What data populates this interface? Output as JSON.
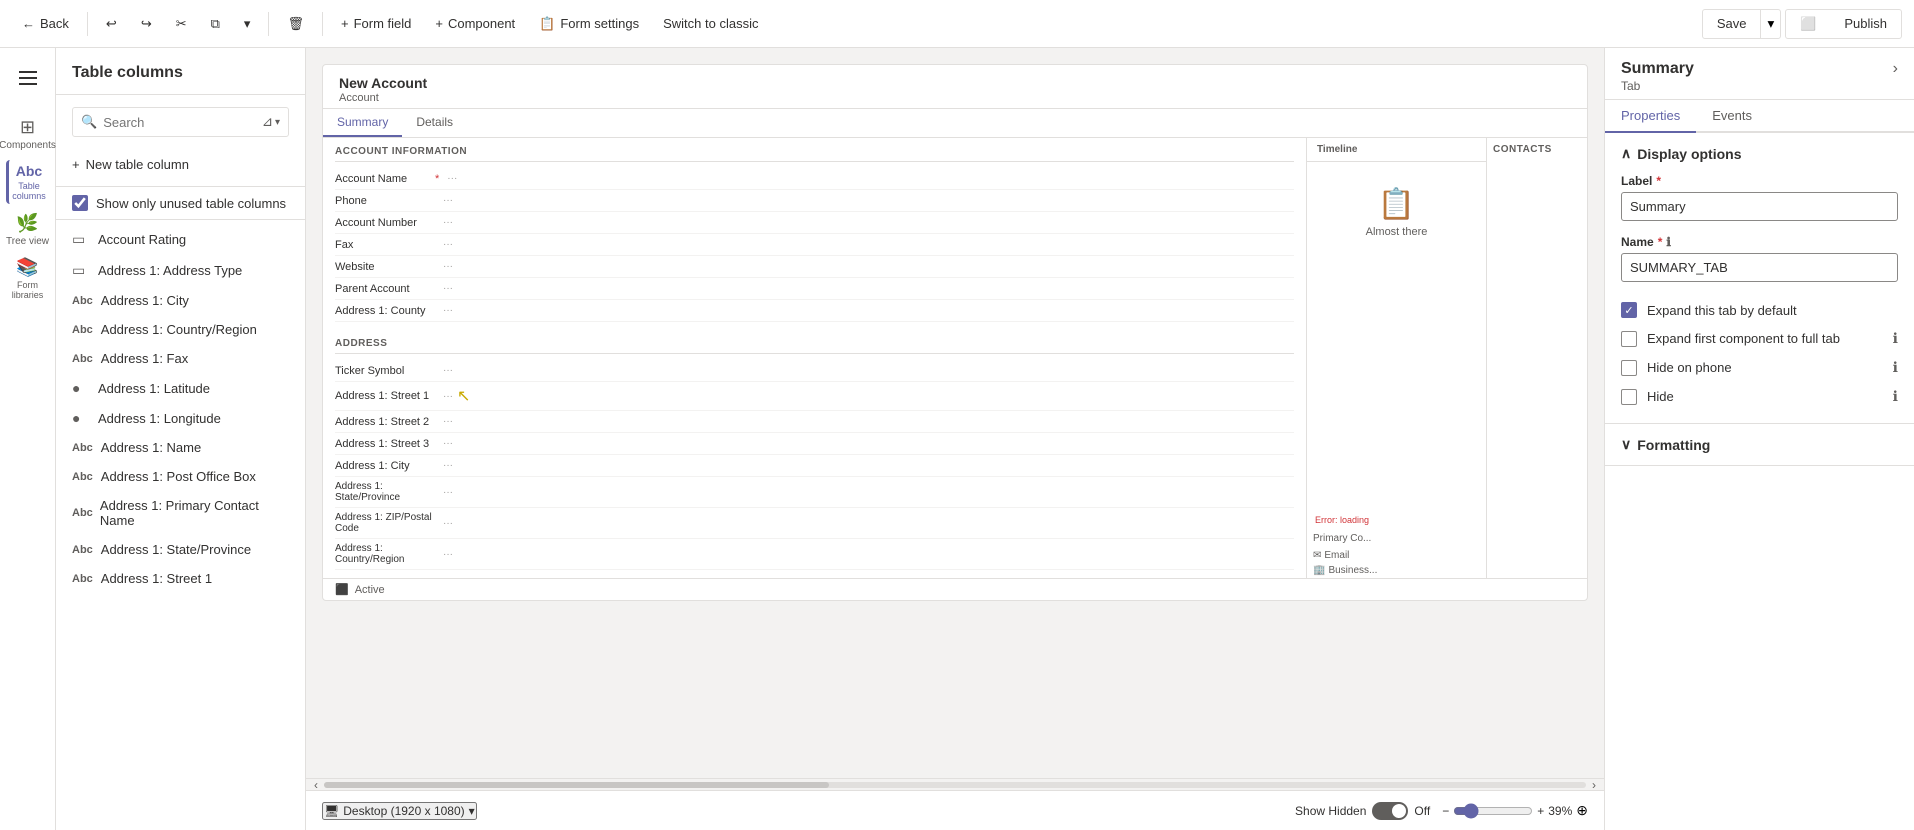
{
  "toolbar": {
    "back_label": "Back",
    "undo_icon": "↩",
    "redo_icon": "↪",
    "cut_icon": "✂",
    "copy_icon": "⧉",
    "dropdown_icon": "▾",
    "delete_icon": "🗑",
    "form_field_label": "Form field",
    "component_label": "Component",
    "form_settings_label": "Form settings",
    "switch_classic_label": "Switch to classic",
    "save_label": "Save",
    "publish_label": "Publish"
  },
  "sidebar": {
    "hamburger_label": "Menu",
    "items": [
      {
        "id": "components",
        "label": "Components",
        "icon": "⊞"
      },
      {
        "id": "table-columns",
        "label": "Table columns",
        "icon": "Abc",
        "active": true
      },
      {
        "id": "tree-view",
        "label": "Tree view",
        "icon": "🌲"
      },
      {
        "id": "form-libraries",
        "label": "Form libraries",
        "icon": "📚"
      }
    ]
  },
  "panel": {
    "title": "Table columns",
    "search_placeholder": "Search",
    "new_column_label": "New table column",
    "show_unused_label": "Show only unused table columns",
    "show_unused_checked": true,
    "items": [
      {
        "id": "account-rating",
        "label": "Account Rating",
        "icon": "▭"
      },
      {
        "id": "address1-type",
        "label": "Address 1: Address Type",
        "icon": "▭"
      },
      {
        "id": "address1-city",
        "label": "Address 1: City",
        "icon": "Abc"
      },
      {
        "id": "address1-country",
        "label": "Address 1: Country/Region",
        "icon": "Abc"
      },
      {
        "id": "address1-fax",
        "label": "Address 1: Fax",
        "icon": "Abc",
        "has_more": true
      },
      {
        "id": "address1-latitude",
        "label": "Address 1: Latitude",
        "icon": "●"
      },
      {
        "id": "address1-longitude",
        "label": "Address 1: Longitude",
        "icon": "●"
      },
      {
        "id": "address1-name",
        "label": "Address 1: Name",
        "icon": "Abc"
      },
      {
        "id": "address1-pobox",
        "label": "Address 1: Post Office Box",
        "icon": "Abc"
      },
      {
        "id": "address1-primary-contact",
        "label": "Address 1: Primary Contact Name",
        "icon": "Abc"
      },
      {
        "id": "address1-state",
        "label": "Address 1: State/Province",
        "icon": "Abc"
      },
      {
        "id": "address1-street1",
        "label": "Address 1: Street 1",
        "icon": "Abc"
      }
    ]
  },
  "form_preview": {
    "title": "New Account",
    "subtitle": "Account",
    "tabs": [
      "Summary",
      "Details"
    ],
    "active_tab": "Summary",
    "account_info_section": {
      "title": "ACCOUNT INFORMATION",
      "fields": [
        {
          "label": "Account Name",
          "required": true
        },
        {
          "label": "Phone"
        },
        {
          "label": "Account Number"
        },
        {
          "label": "Fax"
        },
        {
          "label": "Website"
        },
        {
          "label": "Parent Account"
        },
        {
          "label": "Address 1: County"
        }
      ]
    },
    "timeline_section": {
      "title": "Timeline",
      "icon": "📋",
      "empty_text": "Almost there"
    },
    "address_section": {
      "title": "ADDRESS",
      "fields": [
        {
          "label": "Ticker Symbol"
        },
        {
          "label": "Address 1: Street 1"
        },
        {
          "label": "Address 1: Street 2"
        },
        {
          "label": "Address 1: Street 3"
        },
        {
          "label": "Address 1: City"
        },
        {
          "label": "Address 1: State/Province"
        },
        {
          "label": "Address 1: ZIP/Postal Code"
        },
        {
          "label": "Address 1: Country/Region"
        }
      ]
    },
    "contacts_section": {
      "title": "CONTACTS"
    },
    "footer_status": "Active",
    "error_text": "Error: loading"
  },
  "canvas_bottom": {
    "device_label": "Desktop (1920 x 1080)",
    "show_hidden_label": "Show Hidden",
    "toggle_state": "Off",
    "zoom_label": "39%",
    "globe_icon": "🌐"
  },
  "right_panel": {
    "title": "Summary",
    "subtitle": "Tab",
    "chevron": "›",
    "tabs": [
      "Properties",
      "Events"
    ],
    "active_tab": "Properties",
    "display_options": {
      "title": "Display options",
      "label_field": {
        "label": "Label",
        "required": true,
        "value": "Summary"
      },
      "name_field": {
        "label": "Name",
        "required": true,
        "value": "SUMMARY_TAB"
      },
      "options": [
        {
          "id": "expand-tab",
          "label": "Expand this tab by default",
          "checked": true,
          "has_info": false
        },
        {
          "id": "expand-first",
          "label": "Expand first component to full tab",
          "checked": false,
          "has_info": true
        },
        {
          "id": "hide-phone",
          "label": "Hide on phone",
          "checked": false,
          "has_info": true
        },
        {
          "id": "hide",
          "label": "Hide",
          "checked": false,
          "has_info": true
        }
      ]
    },
    "formatting": {
      "title": "Formatting"
    }
  }
}
